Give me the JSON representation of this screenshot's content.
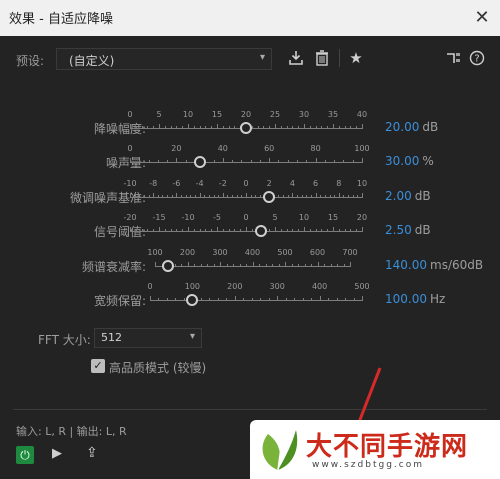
{
  "window": {
    "title": "效果 - 自适应降噪",
    "close_glyph": "✕"
  },
  "preset": {
    "label": "预设:",
    "value": "(自定义)"
  },
  "toolbar_icons": [
    "save-preset-icon",
    "delete-icon",
    "favorite-icon",
    "routing-icon",
    "help-icon"
  ],
  "sliders": [
    {
      "label": "降噪幅度:",
      "ticks": [
        "0",
        "5",
        "10",
        "15",
        "20",
        "25",
        "30",
        "35",
        "40"
      ],
      "value": "20.00",
      "unit": "dB",
      "level": 0.5
    },
    {
      "label": "噪声量:",
      "ticks": [
        "0",
        "20",
        "40",
        "60",
        "80",
        "100"
      ],
      "value": "30.00",
      "unit": "%",
      "level": 0.3
    },
    {
      "label": "微调噪声基准:",
      "ticks": [
        "-10",
        "-8",
        "-6",
        "-4",
        "-2",
        "0",
        "2",
        "4",
        "6",
        "8",
        "10"
      ],
      "value": "2.00",
      "unit": "dB",
      "level": 0.6
    },
    {
      "label": "信号阈值:",
      "ticks": [
        "-20",
        "-15",
        "-10",
        "-5",
        "0",
        "5",
        "10",
        "15",
        "20"
      ],
      "value": "2.50",
      "unit": "dB",
      "level": 0.5625
    },
    {
      "label": "频谱衰减率:",
      "ticks": [
        "100",
        "200",
        "300",
        "400",
        "500",
        "600",
        "700"
      ],
      "value": "140.00",
      "unit": "ms/60dB",
      "level": 0.0667
    },
    {
      "label": "宽频保留:",
      "ticks": [
        "0",
        "100",
        "200",
        "300",
        "400",
        "500"
      ],
      "value": "100.00",
      "unit": "Hz",
      "level": 0.2
    }
  ],
  "fft": {
    "label": "FFT 大小:",
    "value": "512"
  },
  "high_quality": {
    "label": "高品质模式 (较慢)",
    "checked": true
  },
  "io": {
    "text": "输入: L, R | 输出: L, R"
  },
  "transport": {
    "power_glyph": "⏻",
    "play_glyph": "▶",
    "export_glyph": "⇪"
  },
  "watermark": {
    "brand": "大不同手游网",
    "url": "www.szdbtgg.com"
  },
  "colors": {
    "accent": "#3b8ed9",
    "power": "#1e8a3f",
    "brand_red": "#cc2a1a"
  }
}
